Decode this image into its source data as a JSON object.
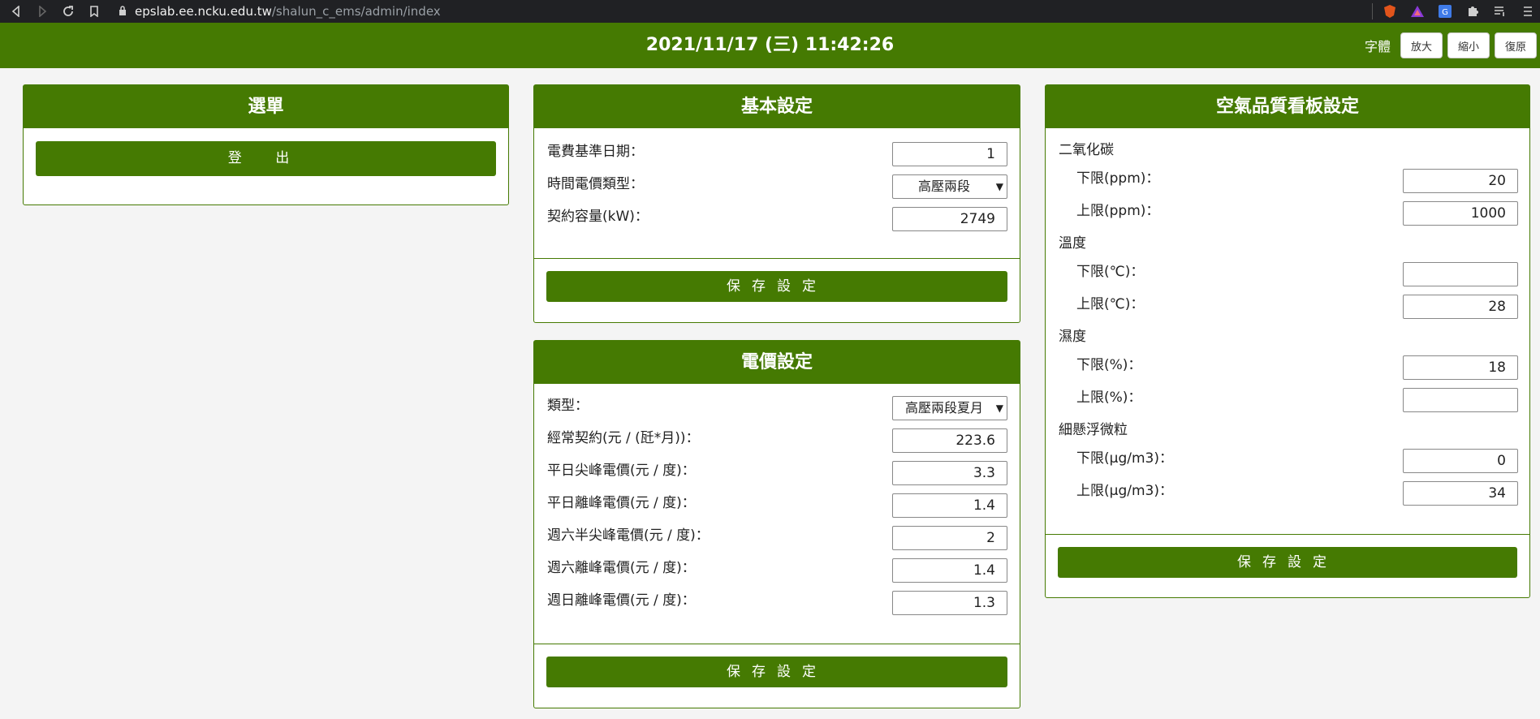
{
  "browser": {
    "url_host": "epslab.ee.ncku.edu.tw",
    "url_path": "/shalun_c_ems/admin/index"
  },
  "header": {
    "datetime": "2021/11/17 (三) 11:42:26",
    "font_label": "字體",
    "font_buttons": [
      "放大",
      "縮小",
      "復原"
    ]
  },
  "menu_panel": {
    "title": "選單",
    "logout": "登 出"
  },
  "basic_panel": {
    "title": "基本設定",
    "rows": [
      {
        "label": "電費基準日期：",
        "value": "1"
      },
      {
        "label": "時間電價類型：",
        "value": "高壓兩段"
      },
      {
        "label": "契約容量(kW)：",
        "value": "2749"
      }
    ],
    "save": "保存設定"
  },
  "price_panel": {
    "title": "電價設定",
    "rows": [
      {
        "label": "類型：",
        "value": "高壓兩段夏月"
      },
      {
        "label": "經常契約(元 / (瓩*月))：",
        "value": "223.6"
      },
      {
        "label": "平日尖峰電價(元 / 度)：",
        "value": "3.3"
      },
      {
        "label": "平日離峰電價(元 / 度)：",
        "value": "1.4"
      },
      {
        "label": "週六半尖峰電價(元 / 度)：",
        "value": "2"
      },
      {
        "label": "週六離峰電價(元 / 度)：",
        "value": "1.4"
      },
      {
        "label": "週日離峰電價(元 / 度)：",
        "value": "1.3"
      }
    ],
    "save": "保存設定"
  },
  "air_panel": {
    "title": "空氣品質看板設定",
    "groups": [
      {
        "name": "二氧化碳",
        "rows": [
          {
            "label": "下限(ppm)：",
            "value": "20"
          },
          {
            "label": "上限(ppm)：",
            "value": "1000"
          }
        ]
      },
      {
        "name": "溫度",
        "rows": [
          {
            "label": "下限(℃)：",
            "value": ""
          },
          {
            "label": "上限(℃)：",
            "value": "28"
          }
        ]
      },
      {
        "name": "濕度",
        "rows": [
          {
            "label": "下限(%)：",
            "value": "18"
          },
          {
            "label": "上限(%)：",
            "value": ""
          }
        ]
      },
      {
        "name": "細懸浮微粒",
        "rows": [
          {
            "label": "下限(μg/m3)：",
            "value": "0"
          },
          {
            "label": "上限(μg/m3)：",
            "value": "34"
          }
        ]
      }
    ],
    "save": "保存設定"
  },
  "icons": [
    "back-icon",
    "forward-icon",
    "reload-icon",
    "bookmark-icon",
    "lock-icon",
    "brave-shield-icon",
    "brave-rewards-icon",
    "translate-icon",
    "extensions-icon",
    "playlist-icon",
    "menu-icon"
  ],
  "colors": {
    "accent": "#457a02",
    "chrome_bg": "#202124"
  }
}
